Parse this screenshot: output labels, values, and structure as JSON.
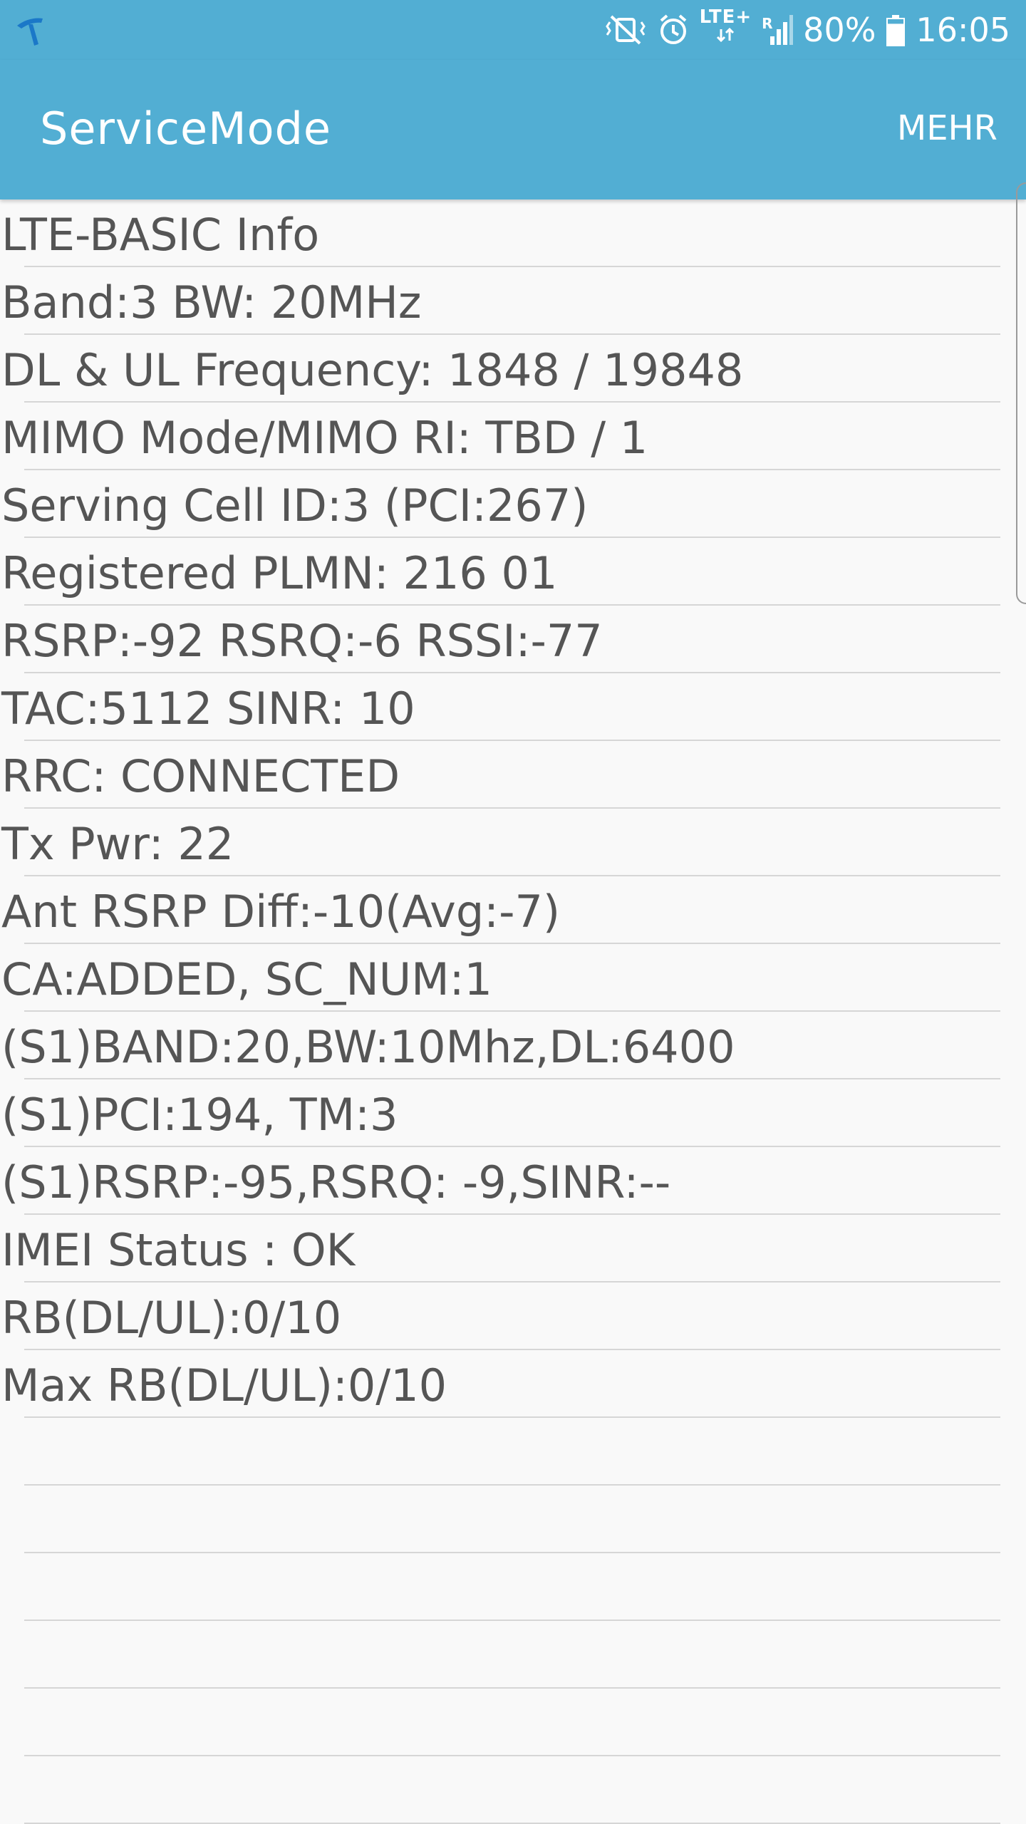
{
  "colors": {
    "accent": "#52aed3",
    "text": "#555555",
    "divider": "#d6d6d6",
    "background": "#f9f9f9"
  },
  "status_bar": {
    "carrier_icon": "telenor-logo-icon",
    "icons": [
      "mute-vibrate-icon",
      "alarm-icon",
      "lte-plus-data-icon",
      "signal-roaming-icon",
      "battery-icon"
    ],
    "network_label": "LTE+",
    "roaming_label": "R",
    "battery_percent": "80%",
    "battery_level": 0.8,
    "time": "16:05"
  },
  "app_bar": {
    "title": "ServiceMode",
    "more_label": "MEHR"
  },
  "info_lines": [
    "LTE-BASIC Info",
    "Band:3 BW: 20MHz",
    "DL & UL Frequency: 1848 / 19848",
    "MIMO Mode/MIMO RI: TBD / 1",
    "Serving Cell ID:3 (PCI:267)",
    "Registered PLMN: 216 01",
    "RSRP:-92 RSRQ:-6 RSSI:-77",
    "TAC:5112 SINR: 10",
    "RRC: CONNECTED",
    "Tx Pwr: 22",
    "Ant RSRP Diff:-10(Avg:-7)",
    "CA:ADDED, SC_NUM:1",
    "(S1)BAND:20,BW:10Mhz,DL:6400",
    "(S1)PCI:194, TM:3",
    "(S1)RSRP:-95,RSRQ: -9,SINR:--",
    "IMEI Status : OK",
    "RB(DL/UL):0/10",
    "Max RB(DL/UL):0/10",
    "",
    "",
    "",
    "",
    "",
    ""
  ]
}
